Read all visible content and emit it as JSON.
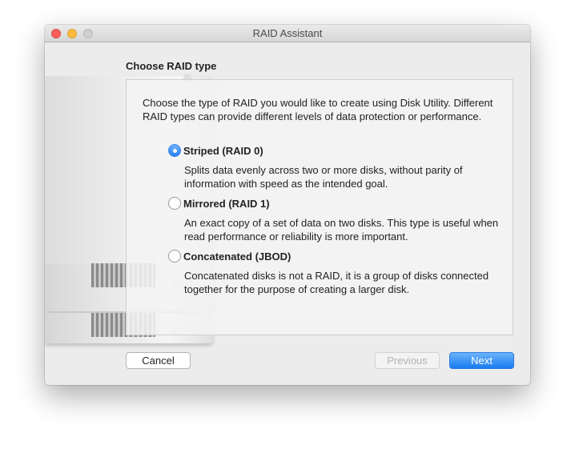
{
  "window": {
    "title": "RAID Assistant"
  },
  "page": {
    "heading": "Choose RAID type",
    "intro": "Choose the type of RAID you would like to create using Disk Utility. Different RAID types can provide different levels of data protection or performance."
  },
  "options": [
    {
      "label": "Striped (RAID 0)",
      "description": "Splits data evenly across two or more disks, without parity of information with speed as the intended goal.",
      "selected": true
    },
    {
      "label": "Mirrored (RAID 1)",
      "description": "An exact copy of a set of data on two disks. This type is useful when read performance or reliability is more important.",
      "selected": false
    },
    {
      "label": "Concatenated (JBOD)",
      "description": "Concatenated disks is not a RAID, it is a group of disks connected together for the purpose of creating a larger disk.",
      "selected": false
    }
  ],
  "buttons": {
    "cancel": "Cancel",
    "previous": "Previous",
    "next": "Next"
  },
  "colors": {
    "accent": "#2a7ef2",
    "close": "#fc605c",
    "minimize": "#fdbc40",
    "zoom_disabled": "#cfcfcf"
  },
  "icons": {
    "disk_artwork": "raid-disk-stack-icon"
  }
}
